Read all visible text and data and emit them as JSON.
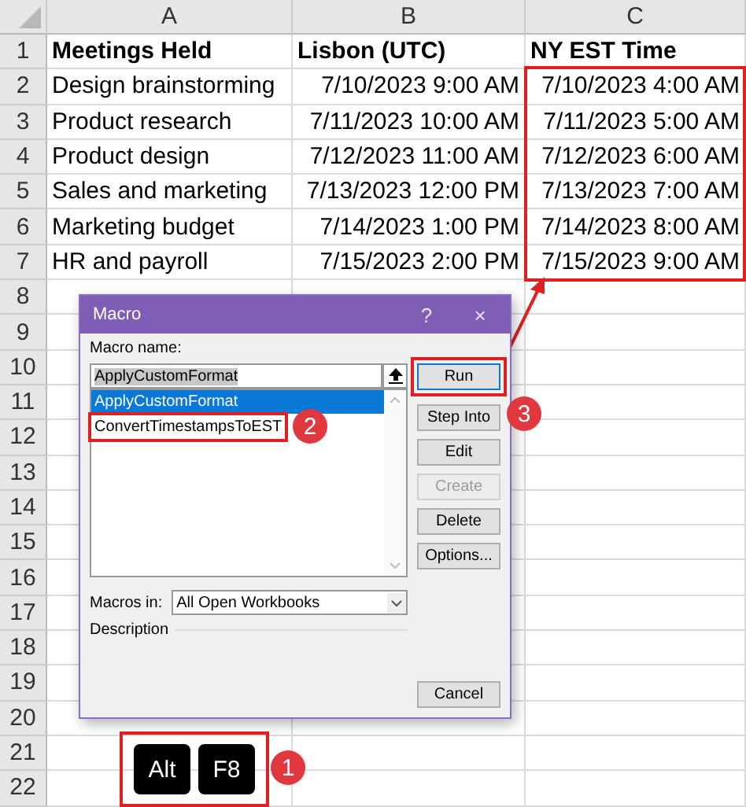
{
  "sheet": {
    "columns": [
      "A",
      "B",
      "C"
    ],
    "rows": [
      {
        "number": "1",
        "cells": [
          "Meetings Held",
          "Lisbon (UTC)",
          "NY EST Time"
        ]
      },
      {
        "number": "2",
        "cells": [
          "Design brainstorming",
          "7/10/2023 9:00 AM",
          "7/10/2023 4:00 AM"
        ]
      },
      {
        "number": "3",
        "cells": [
          "Product research",
          "7/11/2023 10:00 AM",
          "7/11/2023 5:00 AM"
        ]
      },
      {
        "number": "4",
        "cells": [
          "Product design",
          "7/12/2023 11:00 AM",
          "7/12/2023 6:00 AM"
        ]
      },
      {
        "number": "5",
        "cells": [
          "Sales and marketing",
          "7/13/2023 12:00 PM",
          "7/13/2023 7:00 AM"
        ]
      },
      {
        "number": "6",
        "cells": [
          "Marketing budget",
          "7/14/2023 1:00 PM",
          "7/14/2023 8:00 AM"
        ]
      },
      {
        "number": "7",
        "cells": [
          "HR and payroll",
          "7/15/2023 2:00 PM",
          "7/15/2023 9:00 AM"
        ]
      },
      {
        "number": "8",
        "cells": []
      },
      {
        "number": "9",
        "cells": []
      },
      {
        "number": "10",
        "cells": []
      },
      {
        "number": "11",
        "cells": []
      },
      {
        "number": "12",
        "cells": []
      },
      {
        "number": "13",
        "cells": []
      },
      {
        "number": "14",
        "cells": []
      },
      {
        "number": "15",
        "cells": []
      },
      {
        "number": "16",
        "cells": []
      },
      {
        "number": "17",
        "cells": []
      },
      {
        "number": "18",
        "cells": []
      },
      {
        "number": "19",
        "cells": []
      },
      {
        "number": "20",
        "cells": []
      },
      {
        "number": "21",
        "cells": []
      },
      {
        "number": "22",
        "cells": []
      }
    ]
  },
  "dialog": {
    "title": "Macro",
    "help": "?",
    "close": "×",
    "name_label": "Macro name:",
    "name_value": "ApplyCustomFormat",
    "macros": [
      {
        "name": "ApplyCustomFormat",
        "selected": true
      },
      {
        "name": "ConvertTimestampsToEST",
        "selected": false
      }
    ],
    "buttons": [
      {
        "label": "Run",
        "disabled": false
      },
      {
        "label": "Step Into",
        "disabled": false
      },
      {
        "label": "Edit",
        "disabled": false
      },
      {
        "label": "Create",
        "disabled": true
      },
      {
        "label": "Delete",
        "disabled": false
      },
      {
        "label": "Options...",
        "disabled": false
      }
    ],
    "macros_in_label": "Macros in:",
    "macros_in_value": "All Open Workbooks",
    "description_label": "Description",
    "cancel": "Cancel"
  },
  "annotations": {
    "badges": [
      "1",
      "2",
      "3"
    ],
    "keys": [
      "Alt",
      "F8"
    ]
  }
}
